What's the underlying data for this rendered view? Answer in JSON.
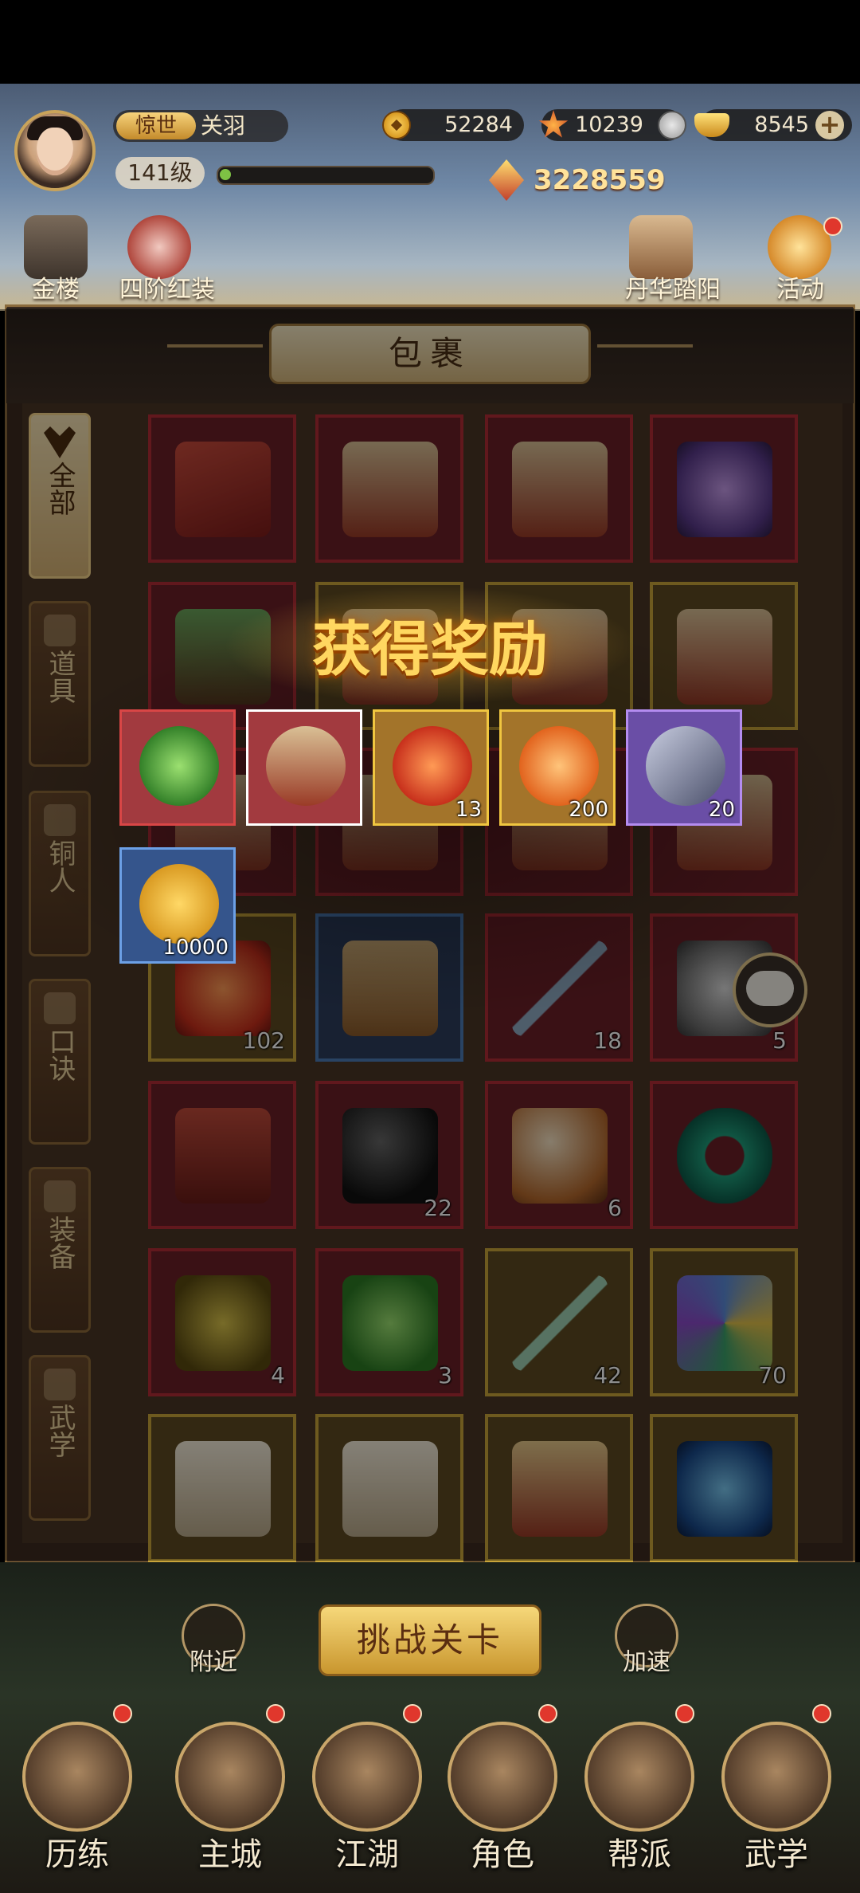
{
  "player": {
    "rank": "惊世",
    "name": "关羽",
    "level": "141级",
    "exp_progress": 0.02,
    "power": "3228559"
  },
  "currencies": [
    {
      "icon": "copper-coin-icon",
      "value": "52284"
    },
    {
      "icon": "spirit-gem-icon",
      "value": "10239"
    },
    {
      "icon": "gold-ingot-icon",
      "value": "8545"
    }
  ],
  "hud_shortcuts": [
    {
      "label": "金楼",
      "icon": "gold-tower-icon"
    },
    {
      "label": "四阶红装",
      "icon": "red-equipment-icon"
    },
    {
      "label": "丹华踏阳",
      "icon": "event-banner-icon"
    },
    {
      "label": "活动",
      "icon": "activity-icon"
    }
  ],
  "bag": {
    "title": "包裹",
    "tabs": [
      "全部",
      "道具",
      "铜人",
      "口诀",
      "装备",
      "武学"
    ],
    "active_tab": "全部",
    "slots": [
      {
        "item": "red-envelope-bundle",
        "count": ""
      },
      {
        "item": "peerless-manual-box",
        "count": ""
      },
      {
        "item": "peerless-manual-box",
        "count": ""
      },
      {
        "item": "purple-orb-stand",
        "count": ""
      },
      {
        "item": "zongzi-box",
        "count": ""
      },
      {
        "item": "manual-box",
        "count": ""
      },
      {
        "item": "manual-box",
        "count": ""
      },
      {
        "item": "manual-box",
        "count": ""
      },
      {
        "item": "manual-box",
        "count": ""
      },
      {
        "item": "manual-box",
        "count": ""
      },
      {
        "item": "manual-box",
        "count": ""
      },
      {
        "item": "manual-box",
        "count": ""
      },
      {
        "item": "red-lantern",
        "count": "102"
      },
      {
        "item": "treasure-chest",
        "count": ""
      },
      {
        "item": "hairpin-bundle",
        "count": "18"
      },
      {
        "item": "stone-bowl",
        "count": "5"
      },
      {
        "item": "shang-token",
        "count": ""
      },
      {
        "item": "black-egg",
        "count": "22"
      },
      {
        "item": "amber-stone",
        "count": "6"
      },
      {
        "item": "jade-ring",
        "count": ""
      },
      {
        "item": "special-stone",
        "count": "4"
      },
      {
        "item": "martial-jade",
        "count": "3"
      },
      {
        "item": "needle-bundle",
        "count": "42"
      },
      {
        "item": "pinwheel-flower",
        "count": "70"
      },
      {
        "item": "qianji-scroll",
        "count": ""
      },
      {
        "item": "qianji-scroll",
        "count": ""
      },
      {
        "item": "qianji-book",
        "count": ""
      },
      {
        "item": "water-orb",
        "count": ""
      }
    ]
  },
  "reward_popup": {
    "title": "获得奖励",
    "items": [
      {
        "item": "martial-jade",
        "count": "",
        "quality": "red"
      },
      {
        "item": "peerless-manual-box",
        "count": "",
        "quality": "red"
      },
      {
        "item": "red-lantern",
        "count": "13",
        "quality": "gold"
      },
      {
        "item": "lotus-medallion",
        "count": "200",
        "quality": "gold"
      },
      {
        "item": "iron-ore",
        "count": "20",
        "quality": "purple"
      },
      {
        "item": "copper-coin",
        "count": "10000",
        "quality": "blue"
      }
    ]
  },
  "bottom": {
    "challenge_label": "挑战关卡",
    "nearby_label": "附近",
    "speedup_label": "加速",
    "nav": [
      "历练",
      "主城",
      "江湖",
      "角色",
      "帮派",
      "武学"
    ]
  },
  "colors": {
    "slot_red_border": "#b12c35",
    "slot_gold_border": "#c8a43a",
    "reward_title": "#ffd760",
    "notification_dot": "#e0372c"
  }
}
